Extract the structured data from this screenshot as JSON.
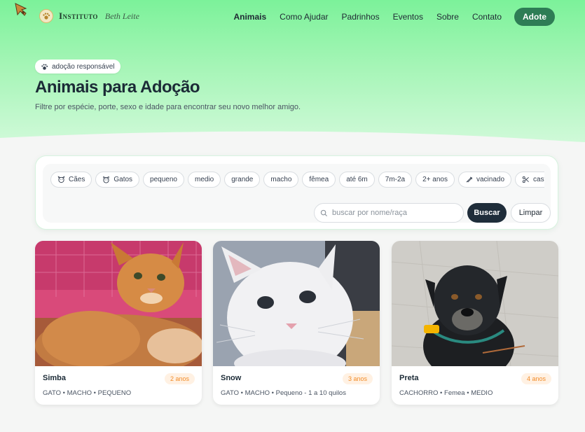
{
  "brand": {
    "name": "Instituto",
    "script": "Beth Leite"
  },
  "nav": {
    "links": [
      "Animais",
      "Como Ajudar",
      "Padrinhos",
      "Eventos",
      "Sobre",
      "Contato"
    ],
    "cta": "Adote"
  },
  "hero": {
    "pill": "adoção responsável",
    "title": "Animais para Adoção",
    "subtitle": "Filtre por espécie, porte, sexo e idade para encontrar seu novo melhor amigo."
  },
  "filters": {
    "chips": [
      {
        "label": "Cães",
        "icon": "dog-icon"
      },
      {
        "label": "Gatos",
        "icon": "cat-icon"
      },
      {
        "label": "pequeno"
      },
      {
        "label": "medio"
      },
      {
        "label": "grande"
      },
      {
        "label": "macho"
      },
      {
        "label": "fêmea"
      },
      {
        "label": "até 6m"
      },
      {
        "label": "7m-2a"
      },
      {
        "label": "2+ anos"
      },
      {
        "label": "vacinado",
        "icon": "syringe-icon"
      },
      {
        "label": "castrado",
        "icon": "scissors-icon"
      }
    ],
    "search_placeholder": "buscar por nome/raça",
    "search_value": "",
    "search_button": "Buscar",
    "clear_button": "Limpar"
  },
  "animals": [
    {
      "name": "Simba",
      "age": "2 anos",
      "meta": "GATO • MACHO • PEQUENO",
      "photo": "orange-tabby-cat"
    },
    {
      "name": "Snow",
      "age": "3 anos",
      "meta": "GATO • MACHO • Pequeno - 1 a 10 quilos",
      "photo": "white-cat"
    },
    {
      "name": "Preta",
      "age": "4 anos",
      "meta": "CACHORRO • Femea • MEDIO",
      "photo": "black-dog"
    }
  ],
  "colors": {
    "accent": "#2e7d55",
    "hero": "#7cf29a",
    "age_badge": "#f28c28",
    "dark_button": "#1f2d3a"
  }
}
